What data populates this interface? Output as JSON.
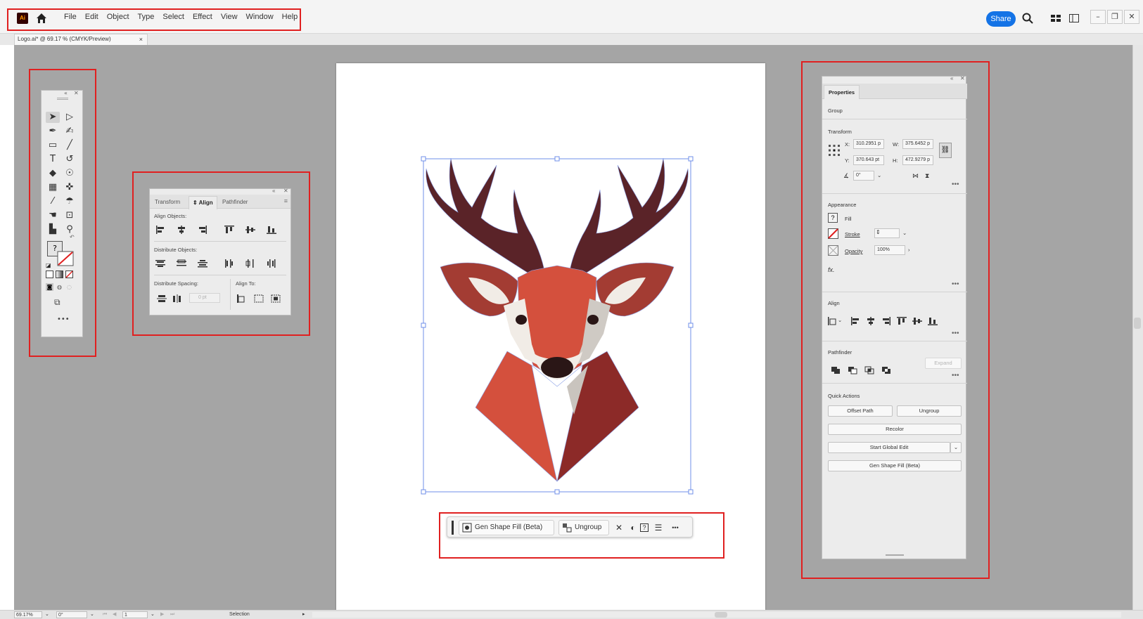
{
  "menubar": {
    "app_logo": "Ai",
    "menus": [
      "File",
      "Edit",
      "Object",
      "Type",
      "Select",
      "Effect",
      "View",
      "Window",
      "Help"
    ],
    "share_label": "Share"
  },
  "document": {
    "tab_title": "Logo.ai* @ 69.17 % (CMYK/Preview)",
    "close_glyph": "×"
  },
  "tools_panel": {
    "fill_placeholder": "?"
  },
  "align_panel": {
    "tabs": [
      "Transform",
      "⇕ Align",
      "Pathfinder"
    ],
    "align_objects_label": "Align Objects:",
    "distribute_objects_label": "Distribute Objects:",
    "distribute_spacing_label": "Distribute Spacing:",
    "align_to_label": "Align To:",
    "spacing_value": "0 pt"
  },
  "context_bar": {
    "gen_shape_fill_label": "Gen Shape Fill (Beta)",
    "ungroup_label": "Ungroup",
    "more_glyph": "•••"
  },
  "properties": {
    "tab_label": "Properties",
    "selection_type": "Group",
    "transform_label": "Transform",
    "x_label": "X:",
    "x_value": "310.2951 p",
    "y_label": "Y:",
    "y_value": "370.643 pt",
    "w_label": "W:",
    "w_value": "375.6452 p",
    "h_label": "H:",
    "h_value": "472.9279 p",
    "angle_value": "0°",
    "appearance_label": "Appearance",
    "fill_label": "Fill",
    "stroke_label": "Stroke",
    "opacity_label": "Opacity",
    "opacity_value": "100%",
    "fx_label": "fx.",
    "align_label": "Align",
    "pathfinder_label": "Pathfinder",
    "expand_label": "Expand",
    "quick_actions_label": "Quick Actions",
    "offset_path_label": "Offset Path",
    "ungroup_label": "Ungroup",
    "recolor_label": "Recolor",
    "start_global_edit_label": "Start Global Edit",
    "gen_shape_fill_label": "Gen Shape Fill (Beta)"
  },
  "statusbar": {
    "zoom": "69.17%",
    "rotation": "0°",
    "artboard_number": "1",
    "tool_name": "Selection"
  },
  "colors": {
    "accent_blue": "#1473e6",
    "annotation_red": "#e02020",
    "antler_brown": "#5a2328",
    "face_red": "#d4503d",
    "dark_red": "#8c2a28",
    "cream": "#f1ece6",
    "selection_blue": "#6f8fe8"
  }
}
